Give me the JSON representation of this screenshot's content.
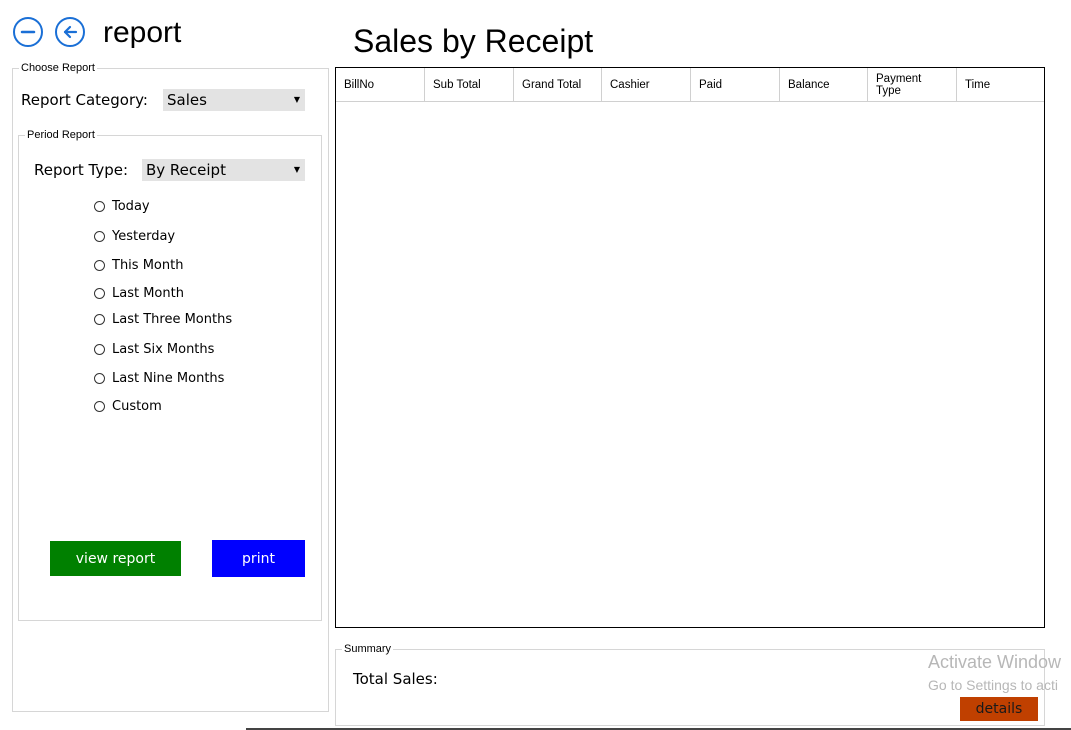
{
  "header": {
    "title": "report",
    "minimize_icon": "minus-circle-icon",
    "back_icon": "arrow-left-circle-icon"
  },
  "choose_report": {
    "legend": "Choose Report",
    "category_label": "Report Category:",
    "category_value": "Sales"
  },
  "period_report": {
    "legend": "Period Report",
    "type_label": "Report Type:",
    "type_value": "By Receipt",
    "options": [
      "Today",
      "Yesterday",
      "This Month",
      "Last Month",
      "Last Three Months",
      "Last Six Months",
      "Last Nine Months",
      "Custom"
    ]
  },
  "buttons": {
    "view_report": "view report",
    "print": "print",
    "details": "details"
  },
  "main": {
    "title": "Sales by Receipt",
    "columns": [
      "BillNo",
      "Sub Total",
      "Grand Total",
      "Cashier",
      "Paid",
      "Balance",
      "Payment Type",
      "Time"
    ]
  },
  "summary": {
    "legend": "Summary",
    "total_label": "Total Sales:"
  },
  "watermark": {
    "line1": "Activate Window",
    "line2": "Go to Settings to acti"
  },
  "colors": {
    "accent_blue": "#1a6fd6",
    "view_report_bg": "#008000",
    "print_bg": "#0000ff",
    "details_bg": "#c04000"
  }
}
